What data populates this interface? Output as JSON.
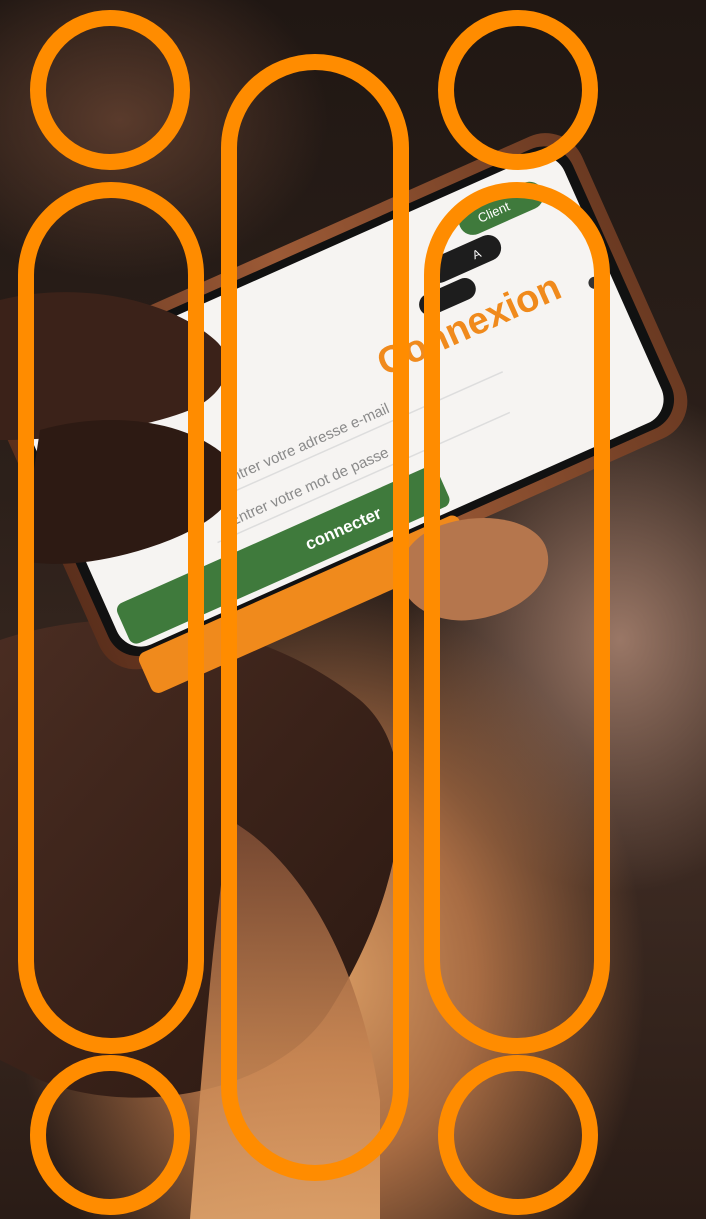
{
  "phone": {
    "tab_client": "Client",
    "tab_second": "A",
    "title": "Connexion",
    "email_placeholder": "Entrer votre adresse e-mail",
    "password_placeholder": "Entrer votre mot de passe",
    "connect_label": "connecter"
  },
  "colors": {
    "ring": "#ff8c00",
    "green": "#3f7a3c",
    "orange": "#f08a1c",
    "dark": "#1d1d1d"
  }
}
